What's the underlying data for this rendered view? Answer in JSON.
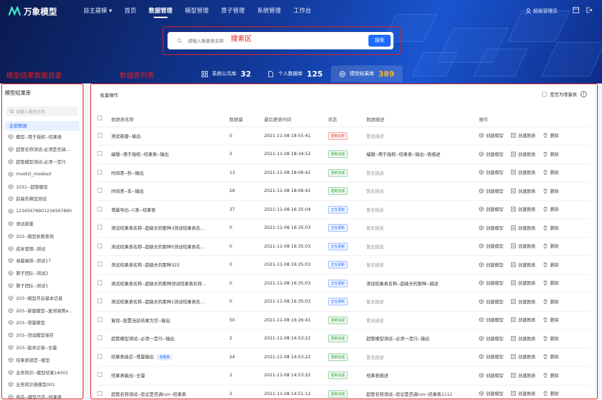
{
  "app": {
    "logo": "万象模型"
  },
  "nav": {
    "items": [
      {
        "label": "自主建模 ▾",
        "active": false
      },
      {
        "label": "首页",
        "active": false
      },
      {
        "label": "数据管理",
        "active": true
      },
      {
        "label": "模型管理",
        "active": false
      },
      {
        "label": "算子管理",
        "active": false
      },
      {
        "label": "系统管理",
        "active": false
      },
      {
        "label": "工作台",
        "active": false
      }
    ],
    "user": "超级管理员"
  },
  "search": {
    "placeholder": "请输入数据表名称",
    "button": "搜索"
  },
  "annotations": {
    "search_area": "搜索区",
    "left_dir": "模型结果数据目录",
    "table_list": "数据表列表"
  },
  "tabs": [
    {
      "label": "系统公共库",
      "count": "32",
      "active": false
    },
    {
      "label": "个人数据库",
      "count": "125",
      "active": false
    },
    {
      "label": "模型结果库",
      "count": "389",
      "active": true
    }
  ],
  "sidebar": {
    "title": "模型结果库",
    "search_placeholder": "请输入模型名称",
    "all_label": "全部数据",
    "items": [
      "模型--用于授权--结果表",
      "超管名称测试-必须是否调...",
      "超管模型测试-必须一定行",
      "mvetst_modesd",
      "1031--超管模型",
      "前端车辆型测试",
      "12345678901234567890",
      "测试新建",
      "203--模型依赖查询",
      "成本管理--测试",
      "调量编排--测试17",
      "算子团队--测试2",
      "算子团队--测试1",
      "203--模型开启基本记录",
      "203--新建模型--复测调用a...",
      "203--增量模型",
      "203--测试模型保存",
      "203--版本记录--全量",
      "结果表锁定--模型",
      "业务知识--模型结果14001",
      "业务知识表模型001",
      "排品--模型日志--结果表"
    ]
  },
  "main": {
    "batch_label": "批量操作",
    "incremental_label": "是否为增量表",
    "columns": [
      "数据表名称",
      "数据量",
      "最后更新时间",
      "状态",
      "数据描述",
      "操作"
    ],
    "rows": [
      {
        "name": "测试新建--输出",
        "count": "0",
        "time": "2021-11-08 18:55:41",
        "status": "更新失败",
        "status_type": "fail",
        "desc": "暂无描述",
        "has_desc": false,
        "tag": ""
      },
      {
        "name": "编辑--用于授权--结果表--输出",
        "count": "2",
        "time": "2021-11-08 18:34:52",
        "status": "更新完成",
        "status_type": "done",
        "desc": "编辑--用于授权--结果表--输出--表描述",
        "has_desc": true,
        "tag": ""
      },
      {
        "name": "时间差--秒--输出",
        "count": "13",
        "time": "2021-11-08 18:06:42",
        "status": "更新完成",
        "status_type": "done",
        "desc": "暂无描述",
        "has_desc": false,
        "tag": ""
      },
      {
        "name": "时间差--年--输出",
        "count": "26",
        "time": "2021-11-08 18:06:42",
        "status": "更新完成",
        "status_type": "done",
        "desc": "暂无描述",
        "has_desc": false,
        "tag": ""
      },
      {
        "name": "增量导出--C表--结果表",
        "count": "37",
        "time": "2021-11-08 16:35:04",
        "status": "正在更新",
        "status_type": "upd",
        "desc": "暂无描述",
        "has_desc": false,
        "tag": ""
      },
      {
        "name": "测试结果表名称--超级长的那种3测试结果表名...",
        "count": "0",
        "time": "2021-11-08 16:35:03",
        "status": "正在更新",
        "status_type": "upd",
        "desc": "暂无描述",
        "has_desc": false,
        "tag": ""
      },
      {
        "name": "测试结果表名称--超级长的那种5测试结果表名...",
        "count": "0",
        "time": "2021-11-08 16:35:03",
        "status": "正在更新",
        "status_type": "upd",
        "desc": "暂无描述",
        "has_desc": false,
        "tag": ""
      },
      {
        "name": "测试结果表名称--超级长的那种322",
        "count": "0",
        "time": "2021-11-08 16:35:03",
        "status": "正在更新",
        "status_type": "upd",
        "desc": "暂无描述",
        "has_desc": false,
        "tag": ""
      },
      {
        "name": "测试结果表名称--超级长的那种测试结果表名称...",
        "count": "0",
        "time": "2021-11-08 16:35:03",
        "status": "正在更新",
        "status_type": "upd",
        "desc": "测试结果表名称--超级长的那种--描述",
        "has_desc": true,
        "tag": ""
      },
      {
        "name": "测试结果表名称--超级长的那种1测试结果表名...",
        "count": "0",
        "time": "2021-11-08 16:35:03",
        "status": "正在更新",
        "status_type": "upd",
        "desc": "暂无描述",
        "has_desc": false,
        "tag": ""
      },
      {
        "name": "复现--配置当前结果为空--输出",
        "count": "50",
        "time": "2021-11-08 16:26:41",
        "status": "更新完成",
        "status_type": "done",
        "desc": "暂无描述",
        "has_desc": false,
        "tag": ""
      },
      {
        "name": "超管模型测试--必须一定行--输出",
        "count": "2",
        "time": "2021-11-08 14:53:22",
        "status": "更新完成",
        "status_type": "done",
        "desc": "超管模型测试--必须一定行--输出",
        "has_desc": true,
        "tag": ""
      },
      {
        "name": "结果表接近--增量输出",
        "count": "24",
        "time": "2021-11-08 14:53:22",
        "status": "更新完成",
        "status_type": "done",
        "desc": "暂无描述",
        "has_desc": false,
        "tag": "增量表"
      },
      {
        "name": "结果表输出--全量",
        "count": "2",
        "time": "2021-11-08 14:53:22",
        "status": "更新完成",
        "status_type": "done",
        "desc": "结果表描述",
        "has_desc": true,
        "tag": ""
      },
      {
        "name": "超管名称测试--验证是否调run--结果表",
        "count": "2",
        "time": "2021-11-08 14:51:12",
        "status": "更新完成",
        "status_type": "done",
        "desc": "超管名称测试--验证是否调run--结果表1111",
        "has_desc": true,
        "tag": ""
      }
    ],
    "ops": {
      "create_model": "创建模型",
      "create_chart": "创建图表",
      "delete": "删除"
    }
  },
  "colors": {
    "accent": "#1f6bff",
    "annotation": "#e32020",
    "hero": "#123a9c"
  }
}
